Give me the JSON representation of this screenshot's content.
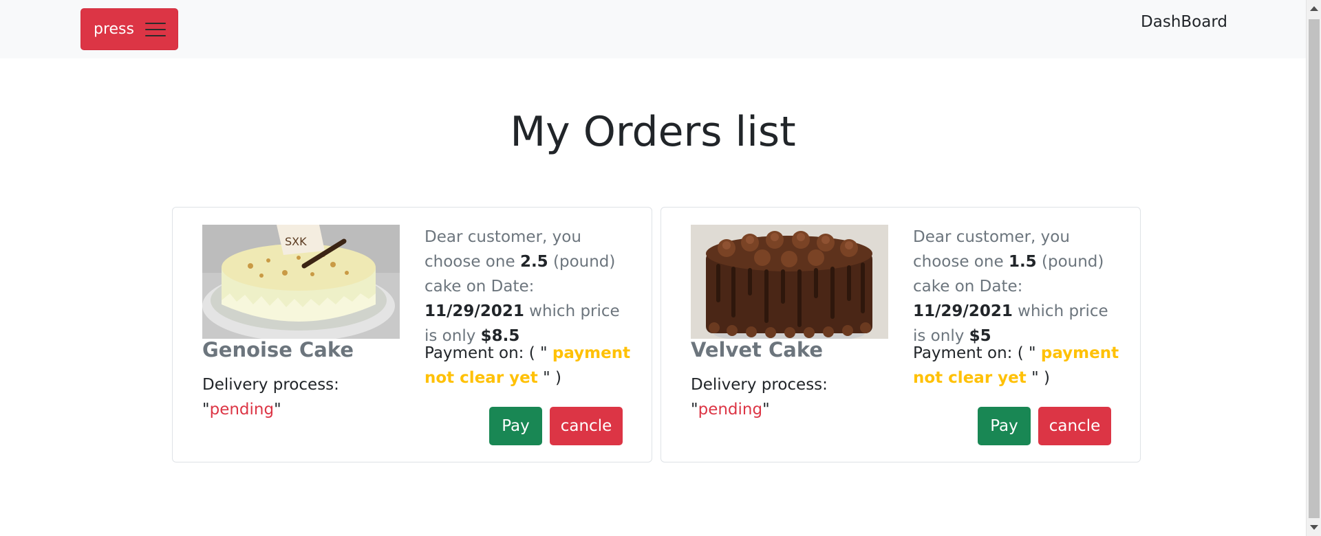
{
  "navbar": {
    "press_label": "press",
    "dashboard_label": "DashBoard"
  },
  "page": {
    "title": "My Orders list"
  },
  "orders": [
    {
      "cake_name": "Genoise Cake",
      "delivery_label": "Delivery process:",
      "delivery_status": "pending",
      "info_prefix": "Dear customer, you choose one",
      "weight": "2.5",
      "weight_unit": "(pound)",
      "date_label": "cake on Date:",
      "date": "11/29/2021",
      "price_label": "which price is only",
      "price": "$8.5",
      "payment_label": "Payment on: ( \"",
      "payment_status": "payment not clear yet",
      "payment_suffix": "\" )",
      "pay_label": "Pay",
      "cancel_label": "cancle"
    },
    {
      "cake_name": "Velvet Cake",
      "delivery_label": "Delivery process:",
      "delivery_status": "pending",
      "info_prefix": "Dear customer, you choose one",
      "weight": "1.5",
      "weight_unit": "(pound)",
      "date_label": "cake on Date:",
      "date": "11/29/2021",
      "price_label": "which price is only",
      "price": "$5",
      "payment_label": "Payment on: ( \"",
      "payment_status": "payment not clear yet",
      "payment_suffix": "\" )",
      "pay_label": "Pay",
      "cancel_label": "cancle"
    }
  ],
  "colors": {
    "danger": "#dc3545",
    "success": "#198754",
    "warning": "#ffc107",
    "muted": "#6c757d",
    "navbar_bg": "#f8f9fa"
  },
  "icons": [
    "hamburger-menu-icon",
    "scroll-up-arrow-icon",
    "scroll-down-arrow-icon"
  ]
}
